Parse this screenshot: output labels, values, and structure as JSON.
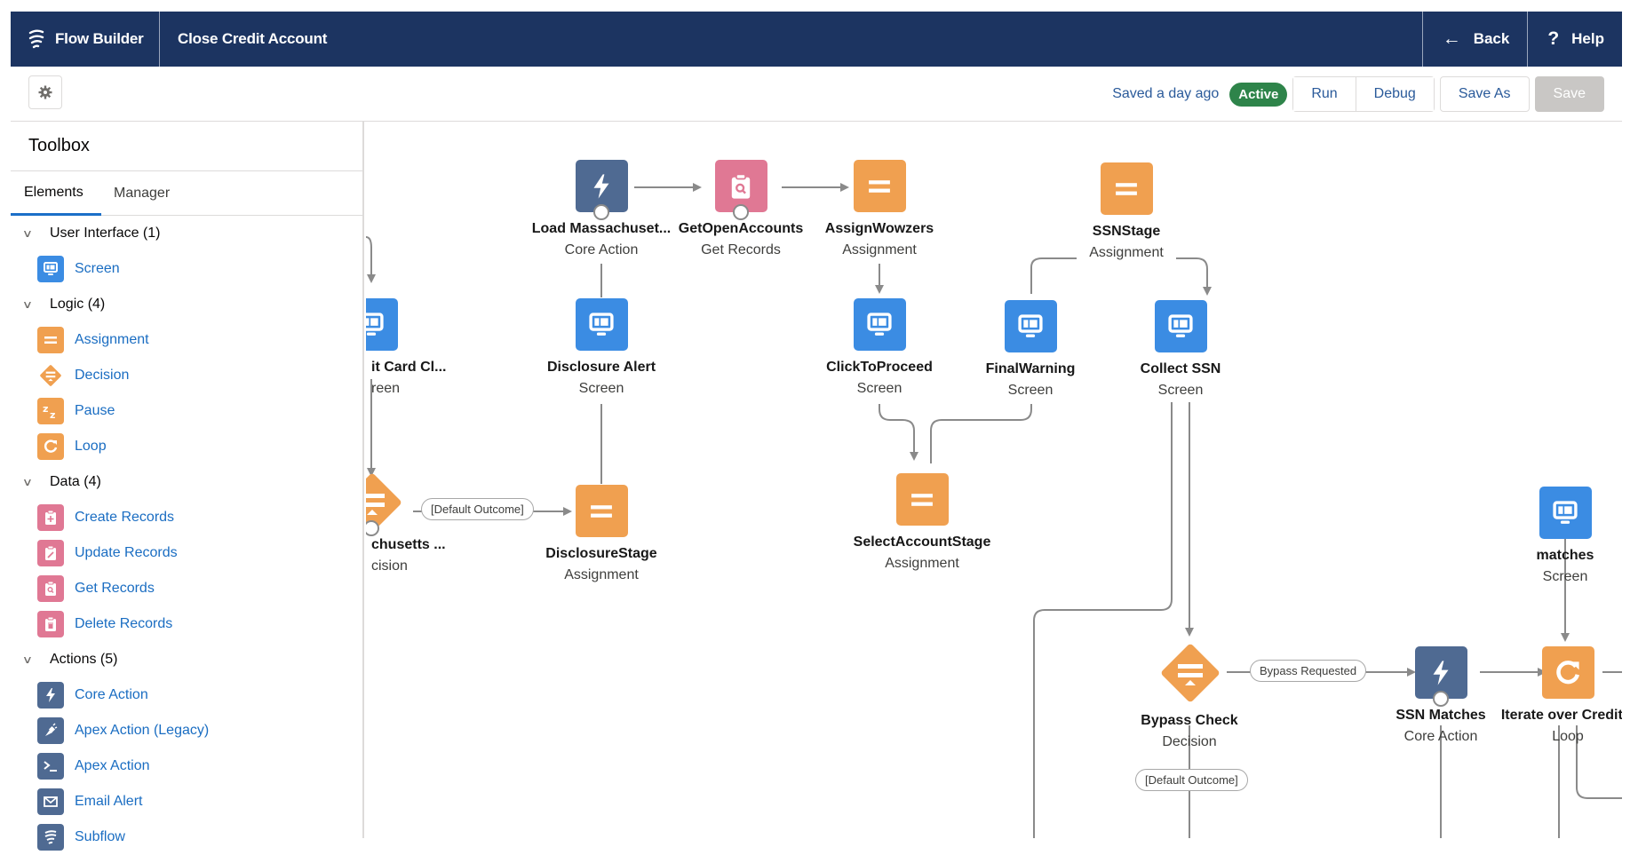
{
  "header": {
    "app_name": "Flow Builder",
    "flow_title": "Close Credit Account",
    "back_label": "Back",
    "help_label": "Help"
  },
  "toolbar": {
    "saved_status": "Saved a day ago",
    "status_badge": "Active",
    "run_label": "Run",
    "debug_label": "Debug",
    "save_as_label": "Save As",
    "save_label": "Save"
  },
  "toolbox": {
    "title": "Toolbox",
    "tabs": [
      {
        "label": "Elements",
        "active": true
      },
      {
        "label": "Manager",
        "active": false
      }
    ],
    "sections": [
      {
        "label": "User Interface (1)",
        "items": [
          {
            "label": "Screen",
            "icon": "screen-icon"
          }
        ]
      },
      {
        "label": "Logic (4)",
        "items": [
          {
            "label": "Assignment",
            "icon": "assignment-icon"
          },
          {
            "label": "Decision",
            "icon": "decision-icon"
          },
          {
            "label": "Pause",
            "icon": "pause-icon"
          },
          {
            "label": "Loop",
            "icon": "loop-icon"
          }
        ]
      },
      {
        "label": "Data (4)",
        "items": [
          {
            "label": "Create Records",
            "icon": "create-records-icon"
          },
          {
            "label": "Update Records",
            "icon": "update-records-icon"
          },
          {
            "label": "Get Records",
            "icon": "get-records-icon"
          },
          {
            "label": "Delete Records",
            "icon": "delete-records-icon"
          }
        ]
      },
      {
        "label": "Actions (5)",
        "items": [
          {
            "label": "Core Action",
            "icon": "core-action-icon"
          },
          {
            "label": "Apex Action (Legacy)",
            "icon": "apex-legacy-icon"
          },
          {
            "label": "Apex Action",
            "icon": "apex-action-icon"
          },
          {
            "label": "Email Alert",
            "icon": "email-alert-icon"
          },
          {
            "label": "Subflow",
            "icon": "subflow-icon"
          }
        ]
      }
    ]
  },
  "canvas": {
    "nodes": {
      "credit_card_screen": {
        "label": "it Card Cl...",
        "type": "reen"
      },
      "massachusetts_decision": {
        "label": "chusetts ...",
        "type": "cision"
      },
      "load_massachusetts": {
        "label": "Load Massachuset...",
        "type": "Core Action"
      },
      "get_open_accounts": {
        "label": "GetOpenAccounts",
        "type": "Get Records"
      },
      "assign_wowzers": {
        "label": "AssignWowzers",
        "type": "Assignment"
      },
      "ssn_stage": {
        "label": "SSNStage",
        "type": "Assignment"
      },
      "disclosure_alert": {
        "label": "Disclosure Alert",
        "type": "Screen"
      },
      "click_to_proceed": {
        "label": "ClickToProceed",
        "type": "Screen"
      },
      "final_warning": {
        "label": "FinalWarning",
        "type": "Screen"
      },
      "collect_ssn": {
        "label": "Collect SSN",
        "type": "Screen"
      },
      "disclosure_stage": {
        "label": "DisclosureStage",
        "type": "Assignment"
      },
      "select_account_stage": {
        "label": "SelectAccountStage",
        "type": "Assignment"
      },
      "matches": {
        "label": "matches",
        "type": "Screen"
      },
      "bypass_check": {
        "label": "Bypass Check",
        "type": "Decision"
      },
      "ssn_matches": {
        "label": "SSN Matches",
        "type": "Core Action"
      },
      "iterate_loop": {
        "label": "Iterate over Credit...",
        "type": "Loop"
      }
    },
    "connector_labels": {
      "massachusetts_default": "[Default Outcome]",
      "bypass_requested": "Bypass Requested",
      "bypass_default": "[Default Outcome]"
    }
  },
  "colors": {
    "header_bg": "#1c3461",
    "screen": "#3b8ce3",
    "logic": "#f0a050",
    "data": "#e07894",
    "action": "#4f6a92",
    "active_badge": "#2e844a"
  }
}
